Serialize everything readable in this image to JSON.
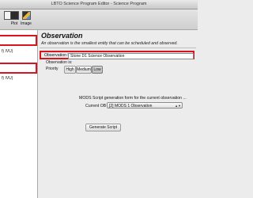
{
  "window": {
    "title": "LBTO Science Program Editor - Science Program"
  },
  "toolbar": {
    "items": [
      {
        "label": "",
        "icon": "document-icon"
      },
      {
        "label": "Plot",
        "icon": "terminal-icon"
      },
      {
        "label": "Image",
        "icon": "image-icon"
      }
    ]
  },
  "tree": {
    "row1_text": "",
    "row2_text": "f) IVU)",
    "row3_text": "",
    "row4_text": "f) IVU)"
  },
  "main": {
    "title": "Observation",
    "description": "An observation is the smallest entity that can be scheduled and observed.",
    "name_label": "Observation Name",
    "name_value": "Stone D1 Science Observation",
    "observation_is_label": "Observation is:",
    "priority_label": "Priority",
    "priority_options": [
      "High",
      "Medium",
      "Low"
    ],
    "priority_selected": "Low",
    "script_form_text": "MODS Script generation form for the current observation ...",
    "current_ob_label": "Current OB",
    "current_ob_value": "[2] MODS 1 Observation",
    "generate_button": "Generate Script"
  },
  "colors": {
    "highlight": "#d8141f"
  }
}
